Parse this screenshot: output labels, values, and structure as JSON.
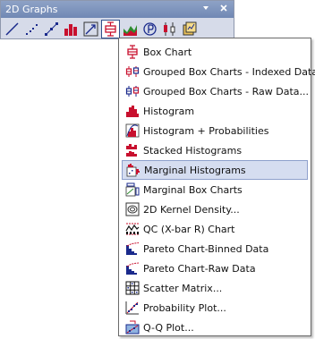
{
  "toolbar": {
    "title": "2D Graphs",
    "dropdown_icon": "dropdown-arrow-icon",
    "close_icon": "close-icon",
    "buttons": [
      {
        "icon": "line-plot-icon"
      },
      {
        "icon": "scatter-plot-icon"
      },
      {
        "icon": "line-symbol-plot-icon"
      },
      {
        "icon": "bar-chart-icon"
      },
      {
        "icon": "vector-plot-icon"
      },
      {
        "icon": "box-chart-icon",
        "active": true
      },
      {
        "icon": "area-chart-icon"
      },
      {
        "icon": "polar-chart-icon"
      },
      {
        "icon": "stock-chart-icon"
      },
      {
        "icon": "template-library-icon"
      }
    ]
  },
  "menu": {
    "items": [
      {
        "label": "Box Chart",
        "icon": "box-chart-icon"
      },
      {
        "label": "Grouped Box Charts - Indexed Data...",
        "icon": "grouped-box-indexed-icon"
      },
      {
        "label": "Grouped Box Charts - Raw Data...",
        "icon": "grouped-box-raw-icon"
      },
      {
        "label": "Histogram",
        "icon": "histogram-icon"
      },
      {
        "label": "Histogram + Probabilities",
        "icon": "histogram-probabilities-icon"
      },
      {
        "label": "Stacked Histograms",
        "icon": "stacked-histograms-icon"
      },
      {
        "label": "Marginal Histograms",
        "icon": "marginal-histograms-icon",
        "highlighted": true
      },
      {
        "label": "Marginal Box Charts",
        "icon": "marginal-box-charts-icon"
      },
      {
        "label": "2D Kernel Density...",
        "icon": "kernel-density-icon"
      },
      {
        "label": "QC (X-bar R) Chart",
        "icon": "qc-chart-icon"
      },
      {
        "label": "Pareto Chart-Binned Data",
        "icon": "pareto-binned-icon"
      },
      {
        "label": "Pareto Chart-Raw Data",
        "icon": "pareto-raw-icon"
      },
      {
        "label": "Scatter Matrix...",
        "icon": "scatter-matrix-icon"
      },
      {
        "label": "Probability Plot...",
        "icon": "probability-plot-icon"
      },
      {
        "label": "Q-Q Plot...",
        "icon": "qq-plot-icon"
      }
    ]
  },
  "colors": {
    "title_bar": "#7a8fbb",
    "toolbar_bg": "#d6dbe9",
    "highlight_bg": "#d5ddf0",
    "highlight_border": "#8ea0cc",
    "icon_red": "#c8102e",
    "icon_blue": "#1a2a8c"
  }
}
